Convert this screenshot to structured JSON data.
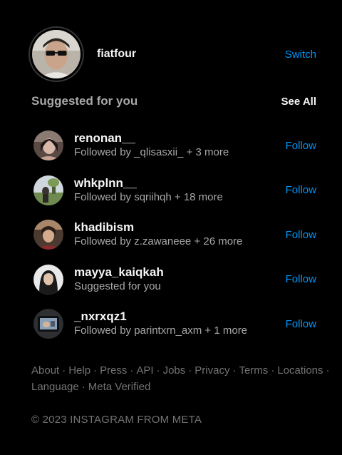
{
  "profile": {
    "username": "fiatfour",
    "switch_label": "Switch"
  },
  "suggestions": {
    "title": "Suggested for you",
    "see_all_label": "See All",
    "items": [
      {
        "username": "renonan__",
        "subtitle": "Followed by _qlisasxii_ + 3 more",
        "action": "Follow"
      },
      {
        "username": "whkplnn__",
        "subtitle": "Followed by sqriihqh + 18 more",
        "action": "Follow"
      },
      {
        "username": "khadibism",
        "subtitle": "Followed by z.zawaneee + 26 more",
        "action": "Follow"
      },
      {
        "username": "mayya_kaiqkah",
        "subtitle": "Suggested for you",
        "action": "Follow"
      },
      {
        "username": "_nxrxqz1",
        "subtitle": "Followed by parintxrn_axm + 1 more",
        "action": "Follow"
      }
    ]
  },
  "footer": {
    "links": [
      "About",
      "Help",
      "Press",
      "API",
      "Jobs",
      "Privacy",
      "Terms",
      "Locations",
      "Language",
      "Meta Verified"
    ],
    "separator": "·",
    "copyright": "© 2023 INSTAGRAM FROM META"
  },
  "colors": {
    "background": "#000000",
    "accent": "#0095f6",
    "muted": "#a8a8a8",
    "footer": "#737373"
  }
}
